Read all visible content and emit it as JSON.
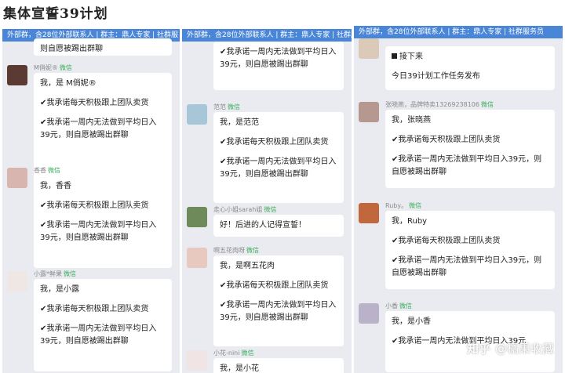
{
  "page_title": "集体宣誓39计划",
  "panels": [
    {
      "header": "外部群，含28位外部联系人 | 群主：鼎人专家 | 社群服",
      "partial_top_text": "则自愿被踢出群聊",
      "messages": [
        {
          "sender": "M俏妮®",
          "tag": "微信",
          "lines": [
            "我，是 M俏妮®",
            "✔我承诺每天积极跟上团队卖货",
            "✔我承诺一周内无法做到平均日入39元，则自愿被踢出群聊"
          ]
        },
        {
          "sender": "香香",
          "tag": "微信",
          "lines": [
            "我，香香",
            "✔我承诺每天积极跟上团队卖货",
            "✔我承诺一周内无法做到平均日入39元，则自愿被踢出群聊"
          ]
        },
        {
          "sender": "小露*鲜果",
          "tag": "微信",
          "lines": [
            "我，是小露",
            "✔我承诺每天积极跟上团队卖货",
            "✔我承诺一周内无法做到平均日入39元，则自愿被踢出群聊"
          ]
        }
      ]
    },
    {
      "header": "外部群，含28位外部联系人 | 群主：鼎人专家 | 社群服",
      "partial_top_text": "✔我承诺一周内无法做到平均日入39元，则自愿被踢出群聊",
      "messages": [
        {
          "sender": "范范",
          "tag": "微信",
          "lines": [
            "我，是范范",
            "✔我承诺每天积极跟上团队卖货",
            "✔我承诺一周内无法做到平均日入39元，则自愿被踢出群聊"
          ]
        },
        {
          "sender": "走心小姐sarah姐",
          "tag": "微信",
          "lines": [
            "好！后进的人记得宣誓！"
          ]
        },
        {
          "sender": "啊五花肉呀",
          "tag": "微信",
          "lines": [
            "我，是啊五花肉",
            "✔我承诺每天积极跟上团队卖货",
            "✔我承诺一周内无法做到平均日入39元，则自愿被踢出群聊"
          ]
        },
        {
          "sender": "小花-nini",
          "tag": "微信",
          "lines": [
            "我，是小花"
          ]
        }
      ]
    },
    {
      "header": "外部群，含28位外部联系人 | 群主：鼎人专家 | 社群服务员",
      "messages": [
        {
          "sender": "",
          "tag": "",
          "lines": [
            "接下来",
            "今日39计划工作任务发布"
          ]
        },
        {
          "sender": "张晓燕，品牌特卖13269238106",
          "tag": "微信",
          "lines": [
            "我，张晓燕",
            "✔我承诺每天积极跟上团队卖货",
            "✔我承诺一周内无法做到平均日入39元，则自愿被踢出群聊"
          ]
        },
        {
          "sender": "Ruby。",
          "tag": "微信",
          "lines": [
            "我，Ruby",
            "✔我承诺每天积极跟上团队卖货",
            "✔我承诺一周内无法做到平均日入39元，则自愿被踢出群聊"
          ]
        },
        {
          "sender": "小香",
          "tag": "微信",
          "lines": [
            "我，是小香",
            "✔我承诺一周内无法做到平均日入39元"
          ]
        }
      ]
    }
  ],
  "watermark": {
    "logo": "知乎",
    "text": "@橘果收藏"
  },
  "colors": {
    "header_bg": "#4a86d8",
    "wechat_green": "#3cae5c",
    "panel_bg": "#e9ebf0"
  }
}
